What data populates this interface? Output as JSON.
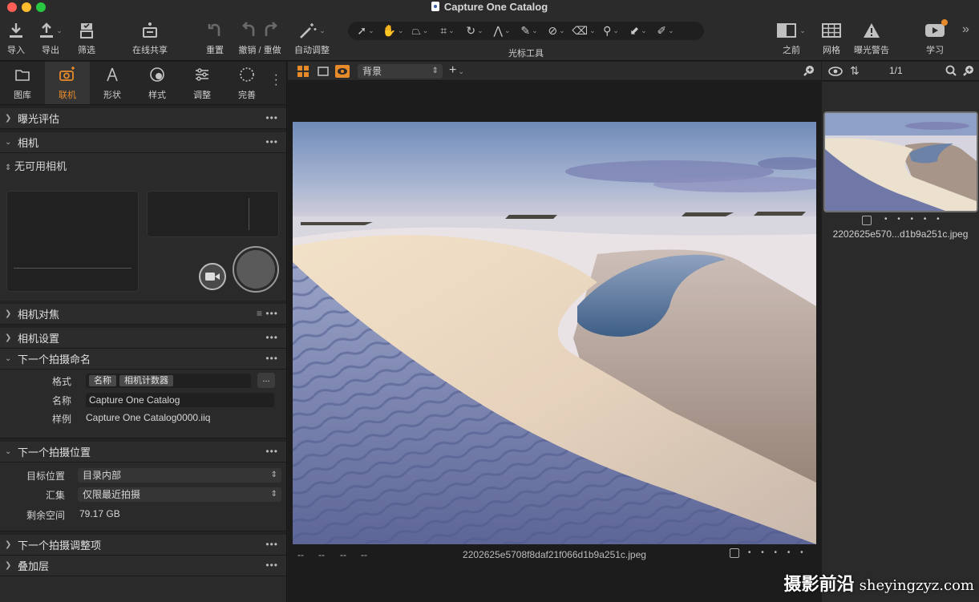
{
  "window": {
    "title": "Capture One Catalog",
    "traffic": [
      "#ff5f57",
      "#febc2e",
      "#28c840"
    ]
  },
  "toolbar": {
    "import": "导入",
    "export": "导出",
    "filter": "筛选",
    "live": "在线共享",
    "reset": "重置",
    "undo_redo": "撤销 / 重做",
    "auto_adjust": "自动调整",
    "cursor_tools": "光标工具",
    "before": "之前",
    "grid": "网格",
    "exposure_warning": "曝光警告",
    "learn": "学习"
  },
  "tabs": [
    {
      "label": "图库",
      "icon": "folder-icon"
    },
    {
      "label": "联机",
      "icon": "camera-icon",
      "active": true
    },
    {
      "label": "形状",
      "icon": "compass-icon"
    },
    {
      "label": "样式",
      "icon": "style-icon"
    },
    {
      "label": "调整",
      "icon": "sliders-icon"
    },
    {
      "label": "完善",
      "icon": "refine-icon"
    }
  ],
  "sections": {
    "exposure_eval": "曝光评估",
    "camera": "相机",
    "no_camera": "无可用相机",
    "camera_focus": "相机对焦",
    "camera_settings": "相机设置",
    "next_capture_naming": "下一个拍摄命名",
    "next_capture_location": "下一个拍摄位置",
    "next_capture_adjustments": "下一个拍摄调整项",
    "overlay": "叠加层"
  },
  "naming": {
    "format_label": "格式",
    "tokens": [
      "名称",
      "相机计数器"
    ],
    "more": "...",
    "name_label": "名称",
    "name_value": "Capture One Catalog",
    "sample_label": "样例",
    "sample_value": "Capture One Catalog0000.iiq"
  },
  "location": {
    "dest_label": "目标位置",
    "dest_value": "目录内部",
    "collection_label": "汇集",
    "collection_value": "仅限最近拍摄",
    "space_label": "剩余空间",
    "space_value": "79.17 GB"
  },
  "viewer": {
    "background_select": "背景",
    "meta": [
      "--",
      "--",
      "--",
      "--"
    ],
    "filename": "2202625e5708f8daf21f066d1b9a251c.jpeg",
    "rating_dots": "• • • • •"
  },
  "browser": {
    "count": "1/1",
    "thumb_name": "2202625e570...d1b9a251c.jpeg",
    "rating_dots": "• • • • •"
  },
  "watermark": {
    "cn": "摄影前沿",
    "url": "sheyingzyz.com"
  },
  "colors": {
    "accent": "#e78a2a"
  }
}
